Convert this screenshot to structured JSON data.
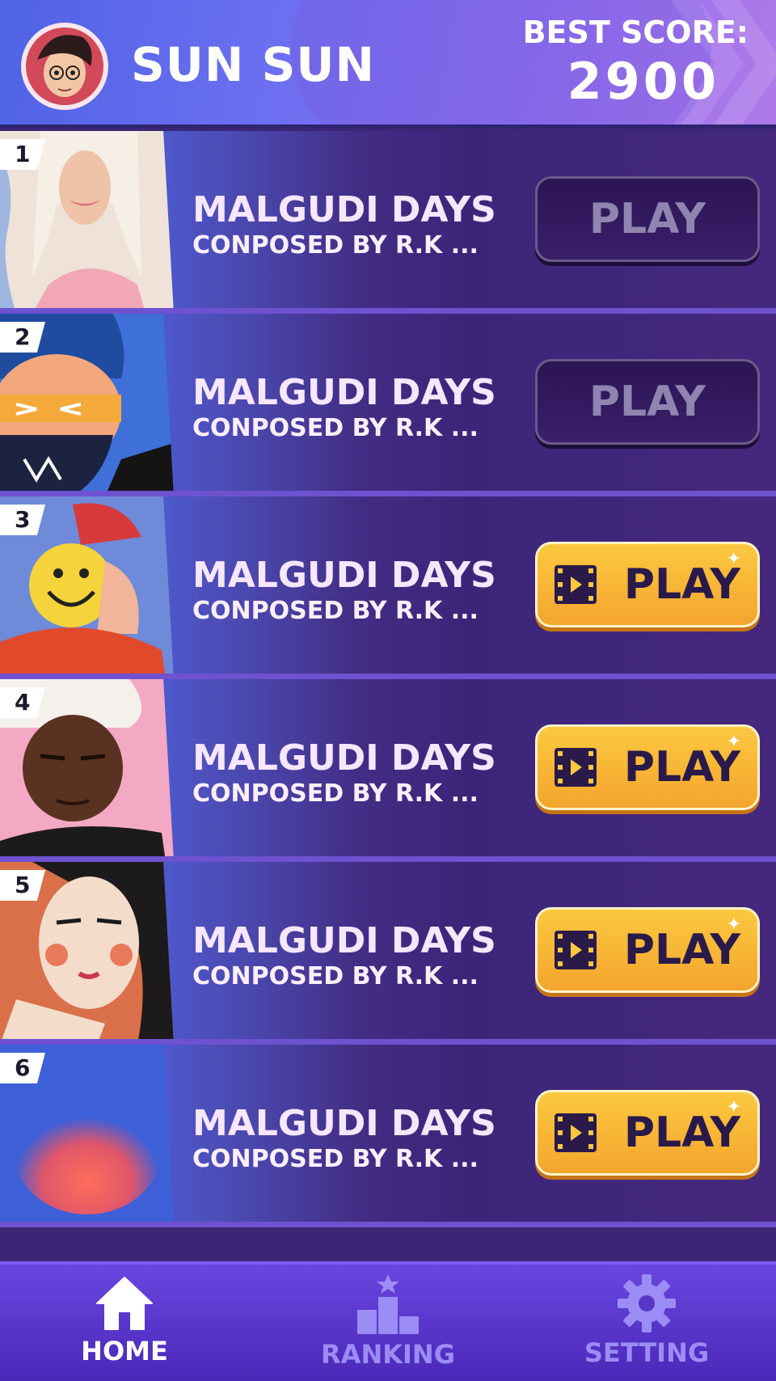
{
  "header": {
    "player_name": "SUN SUN",
    "best_score_label": "BEST SCORE:",
    "best_score_value": "2900"
  },
  "songs": [
    {
      "rank": "1",
      "title": "MALGUDI DAYS",
      "subtitle": "CONPOSED BY R.K ...",
      "play_label": "PLAY",
      "state": "locked"
    },
    {
      "rank": "2",
      "title": "MALGUDI DAYS",
      "subtitle": "CONPOSED BY R.K ...",
      "play_label": "PLAY",
      "state": "locked"
    },
    {
      "rank": "3",
      "title": "MALGUDI DAYS",
      "subtitle": "CONPOSED BY R.K ...",
      "play_label": "PLAY",
      "state": "video"
    },
    {
      "rank": "4",
      "title": "MALGUDI DAYS",
      "subtitle": "CONPOSED BY R.K ...",
      "play_label": "PLAY",
      "state": "video"
    },
    {
      "rank": "5",
      "title": "MALGUDI DAYS",
      "subtitle": "CONPOSED BY R.K ...",
      "play_label": "PLAY",
      "state": "video"
    },
    {
      "rank": "6",
      "title": "MALGUDI DAYS",
      "subtitle": "CONPOSED BY R.K ...",
      "play_label": "PLAY",
      "state": "video"
    }
  ],
  "nav": {
    "home": "HOME",
    "ranking": "RANKING",
    "setting": "SETTING"
  },
  "colors": {
    "accent_yellow": "#fbc840",
    "nav_active": "#ffffff",
    "nav_inactive": "#9c8cf5"
  }
}
